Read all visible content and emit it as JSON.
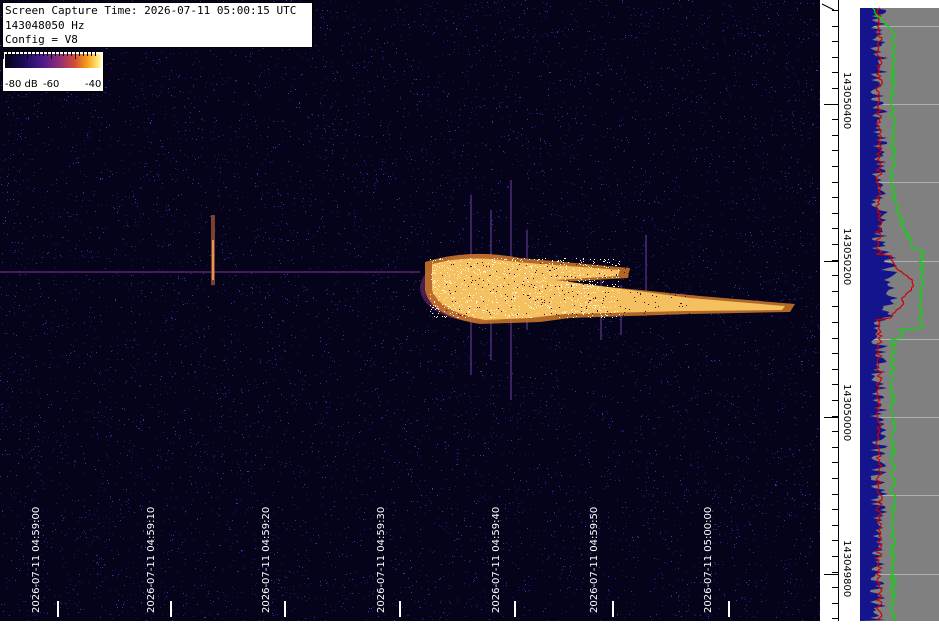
{
  "header": {
    "capture_time": "Screen Capture Time: 2026-07-11 05:00:15 UTC",
    "frequency": "143048050 Hz",
    "config": "Config = V8"
  },
  "colorbar": {
    "min_label": "-80 dB",
    "mid_label": "-60",
    "max_label": "-40"
  },
  "time_axis": {
    "labels": [
      "2026-07-11 04:59:00",
      "2026-07-11 04:59:10",
      "2026-07-11 04:59:20",
      "2026-07-11 04:59:30",
      "2026-07-11 04:59:40",
      "2026-07-11 04:59:50",
      "2026-07-11 05:00:00"
    ]
  },
  "freq_axis": {
    "labels": [
      "143050400",
      "143050200",
      "143050000",
      "143049800"
    ]
  },
  "colors": {
    "background": "#04031a",
    "noise": "#2a2a9a",
    "echo_core": "#fff6c0",
    "echo_edge": "#e08a2a",
    "spectrum_bg": "#808080",
    "spectrum_green": "#00e000",
    "spectrum_red": "#d00000",
    "spectrum_blue": "#1010a0"
  }
}
